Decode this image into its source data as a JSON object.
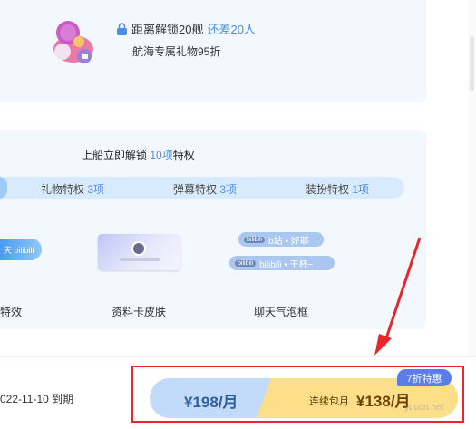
{
  "top": {
    "lock_prefix": "距离解锁20舰",
    "lock_suffix": "还差20人",
    "sub": "航海专属礼物95折"
  },
  "privileges": {
    "title_prefix": "上船立即解锁",
    "title_count": "10项",
    "title_suffix": "特权",
    "tabs": [
      {
        "label": "礼物特权",
        "count": "3项"
      },
      {
        "label": "弹幕特权",
        "count": "3项"
      },
      {
        "label": "装扮特权",
        "count": "1项"
      }
    ],
    "fx_strip_text": "天 bilibili",
    "bubble1": {
      "tag": "bilibili",
      "text": "b站 • 好耶"
    },
    "bubble2": {
      "tag": "bilibili",
      "text": "bilibili • 干杯~"
    },
    "captions": {
      "effect": "特效",
      "card_skin": "资料卡皮肤",
      "bubble": "聊天气泡框"
    }
  },
  "bottom": {
    "expire": "022-11-10 到期",
    "month_price": "¥198/月",
    "auto_label": "连续包月",
    "auto_price": "¥138/月",
    "discount_badge": "7折特惠",
    "watermark": "yuucn.net"
  },
  "colors": {
    "accent": "#4a8fe8",
    "highlight_box": "#e8262b"
  }
}
